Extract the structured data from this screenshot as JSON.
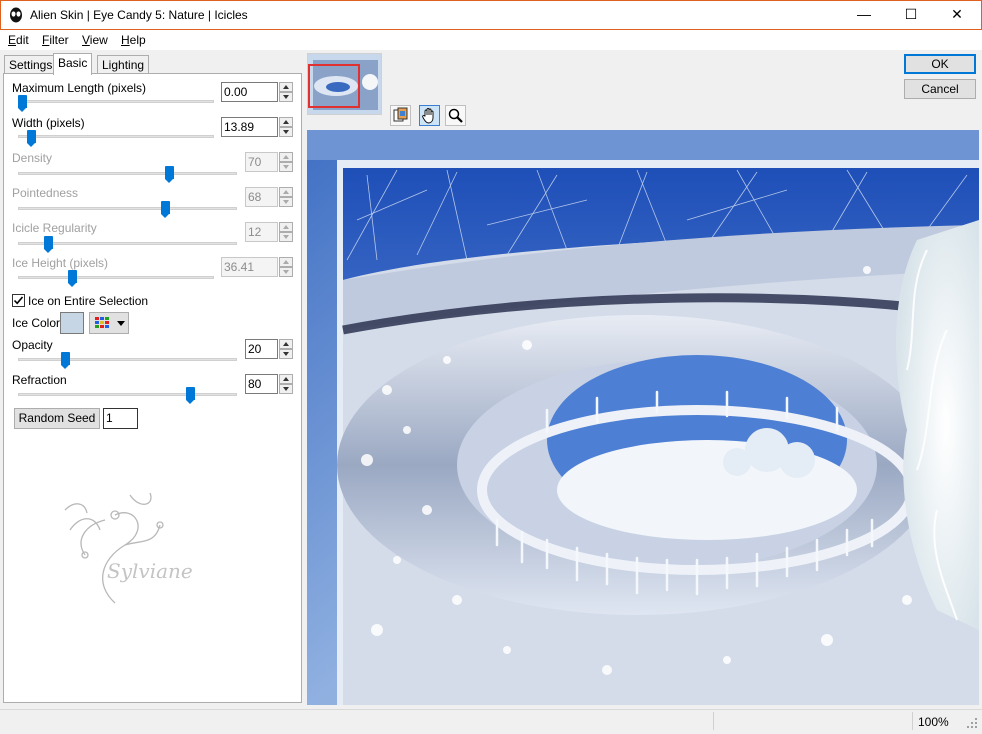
{
  "window": {
    "title": "Alien Skin | Eye Candy 5: Nature | Icicles",
    "controls": {
      "minimize": "—",
      "maximize": "☐",
      "close": "✕"
    }
  },
  "menu": [
    {
      "label": "Edit",
      "mnemonic": "E",
      "rest": "dit"
    },
    {
      "label": "Filter",
      "mnemonic": "F",
      "rest": "ilter"
    },
    {
      "label": "View",
      "mnemonic": "V",
      "rest": "iew"
    },
    {
      "label": "Help",
      "mnemonic": "H",
      "rest": "elp"
    }
  ],
  "tabs": {
    "settings": "Settings",
    "basic": "Basic",
    "lighting": "Lighting",
    "active": "Basic"
  },
  "controls": {
    "max_length": {
      "label": "Maximum Length (pixels)",
      "value": "0.00",
      "level": 0.0
    },
    "width": {
      "label": "Width (pixels)",
      "value": "13.89",
      "level": 0.06
    },
    "density": {
      "label": "Density",
      "value": "70",
      "level": 0.68
    },
    "pointedness": {
      "label": "Pointedness",
      "value": "68",
      "level": 0.66
    },
    "regularity": {
      "label": "Icicle Regularity",
      "value": "12",
      "level": 0.13
    },
    "ice_height": {
      "label": "Ice Height (pixels)",
      "value": "36.41",
      "level": 0.28
    },
    "ice_on_entire": {
      "label": "Ice on Entire Selection",
      "checked": true
    },
    "ice_color": {
      "label": "Ice Color",
      "swatch": "#c6d6e4"
    },
    "opacity": {
      "label": "Opacity",
      "value": "20",
      "level": 0.2
    },
    "refraction": {
      "label": "Refraction",
      "value": "80",
      "level": 0.78
    },
    "random_seed": {
      "label": "Random Seed",
      "value": "1"
    }
  },
  "watermark": {
    "text": "Sylviane"
  },
  "buttons": {
    "ok": "OK",
    "cancel": "Cancel"
  },
  "tools": {
    "compare": "compare-icon",
    "hand": "hand-icon",
    "zoom": "zoom-icon"
  },
  "status": {
    "zoom": "100%"
  }
}
